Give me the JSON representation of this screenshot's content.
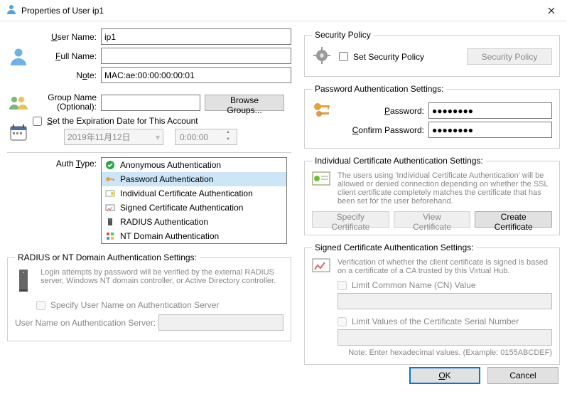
{
  "window": {
    "title": "Properties of User ip1"
  },
  "left": {
    "user_name_label": "User Name:",
    "user_name_value": "ip1",
    "full_name_label": "Full Name:",
    "full_name_value": "",
    "note_label": "Note:",
    "note_value": "MAC:ae:00:00:00:00:01",
    "group_name_label_line1": "Group Name",
    "group_name_label_line2": "(Optional):",
    "group_name_value": "",
    "browse_groups": "Browse Groups...",
    "set_expiration_label": "Set the Expiration Date for This Account",
    "date_value": "2019年11月12日",
    "time_value": "0:00:00",
    "auth_type_label": "Auth Type:",
    "auth_types": [
      "Anonymous Authentication",
      "Password Authentication",
      "Individual Certificate Authentication",
      "Signed Certificate Authentication",
      "RADIUS Authentication",
      "NT Domain Authentication"
    ],
    "radius_fieldset": "RADIUS or NT Domain Authentication Settings:",
    "radius_info": "Login attempts by password will be verified by the external RADIUS server, Windows NT domain controller, or Active Directory controller.",
    "specify_user_name": "Specify User Name on Authentication Server",
    "user_name_on_server_label": "User Name on Authentication Server:",
    "user_name_on_server_value": ""
  },
  "right": {
    "security_fieldset": "Security Policy",
    "set_security_policy": "Set Security Policy",
    "security_policy_btn": "Security Policy",
    "pwd_fieldset": "Password Authentication Settings:",
    "password_label": "Password:",
    "password_value": "●●●●●●●●",
    "confirm_password_label": "Confirm Password:",
    "confirm_password_value": "●●●●●●●●",
    "indcert_fieldset": "Individual Certificate Authentication Settings:",
    "indcert_info": "The users using 'Individual Certificate Authentication' will be allowed or denied connection depending on whether the SSL client certificate completely matches the certificate that has been set for the user beforehand.",
    "specify_cert": "Specify Certificate",
    "view_cert": "View Certificate",
    "create_cert": "Create Certificate",
    "signed_fieldset": "Signed Certificate Authentication Settings:",
    "signed_info": "Verification of whether the client certificate is signed is based on a certificate of a CA trusted by this Virtual Hub.",
    "limit_cn": "Limit Common Name (CN) Value",
    "limit_cn_value": "",
    "limit_serial": "Limit Values of the Certificate Serial Number",
    "limit_serial_value": "",
    "hex_note": "Note: Enter hexadecimal values. (Example: 0155ABCDEF)"
  },
  "footer": {
    "ok": "OK",
    "cancel": "Cancel"
  }
}
